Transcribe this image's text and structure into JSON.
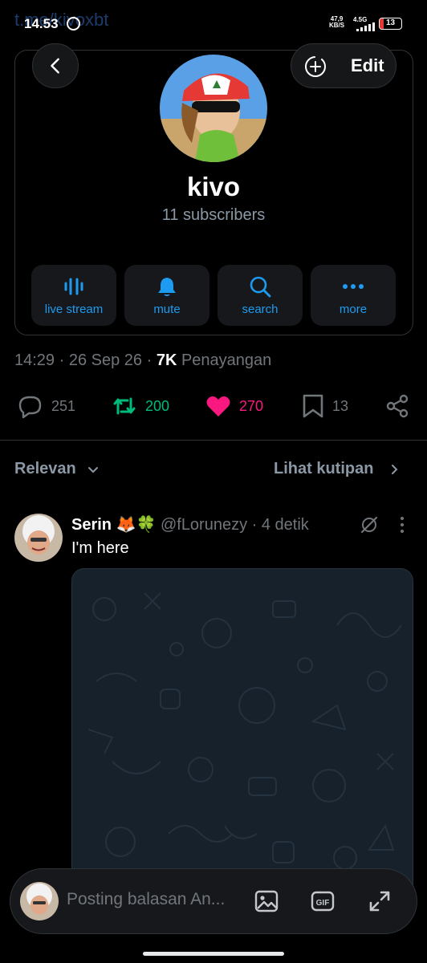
{
  "status_bar": {
    "ghost_url": "t.me/kivoxbt",
    "time": "14.53",
    "net_speed_value": "47,9",
    "net_speed_unit": "KB/S",
    "network_type": "4.5G",
    "battery": "13"
  },
  "header": {
    "edit_label": "Edit"
  },
  "channel": {
    "name": "kivo",
    "subscribers": "11 subscribers"
  },
  "actions": [
    {
      "label": "live stream",
      "icon": "live-stream-icon"
    },
    {
      "label": "mute",
      "icon": "bell-icon"
    },
    {
      "label": "search",
      "icon": "search-icon"
    },
    {
      "label": "more",
      "icon": "more-dots-icon"
    }
  ],
  "meta": {
    "time": "14:29",
    "date": "26 Sep 26",
    "views": "7K",
    "views_label": "Penayangan"
  },
  "stats": {
    "replies": "251",
    "reposts": "200",
    "likes": "270",
    "bookmarks": "13"
  },
  "sort": {
    "label": "Relevan",
    "quotes_link": "Lihat kutipan"
  },
  "reply": {
    "name": "Serin 🦊🍀",
    "handle": "@fLorunezy",
    "time": "4 detik",
    "text": "I'm here"
  },
  "composer": {
    "placeholder": "Posting balasan An..."
  },
  "colors": {
    "accent": "#1d9bf0",
    "repost": "#00ba7c",
    "like": "#f91880",
    "muted": "#71767b",
    "background": "#000000"
  }
}
